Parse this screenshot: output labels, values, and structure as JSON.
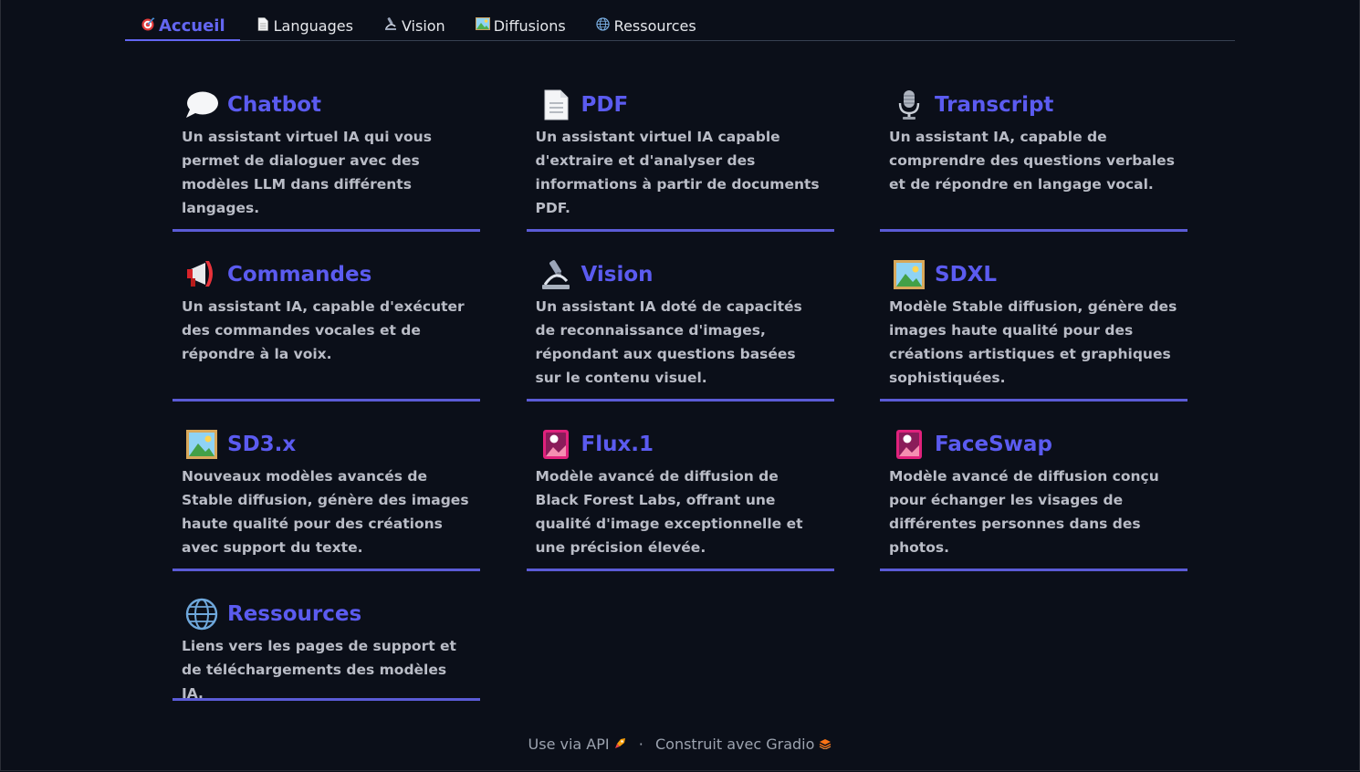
{
  "tabs": [
    {
      "label": "Accueil",
      "icon": "target-icon",
      "active": true
    },
    {
      "label": "Languages",
      "icon": "document-icon",
      "active": false
    },
    {
      "label": "Vision",
      "icon": "microscope-icon",
      "active": false
    },
    {
      "label": "Diffusions",
      "icon": "picture-icon",
      "active": false
    },
    {
      "label": "Ressources",
      "icon": "globe-icon",
      "active": false
    }
  ],
  "cards": [
    {
      "title": "Chatbot",
      "icon": "speech-bubble-icon",
      "desc": "Un assistant virtuel IA qui vous permet de dialoguer avec des modèles LLM dans différents langages."
    },
    {
      "title": "PDF",
      "icon": "document-icon",
      "desc": "Un assistant virtuel IA capable d'extraire et d'analyser des informations à partir de documents PDF."
    },
    {
      "title": "Transcript",
      "icon": "microphone-icon",
      "desc": "Un assistant IA, capable de comprendre des questions verbales et de répondre en langage vocal."
    },
    {
      "title": "Commandes",
      "icon": "megaphone-icon",
      "desc": "Un assistant IA, capable d'exécuter des commandes vocales et de répondre à la voix."
    },
    {
      "title": "Vision",
      "icon": "microscope-icon",
      "desc": "Un assistant IA doté de capacités de reconnaissance d'images, répondant aux questions basées sur le contenu visuel."
    },
    {
      "title": "SDXL",
      "icon": "picture-icon",
      "desc": "Modèle Stable diffusion, génère des images haute qualité pour des créations artistiques et graphiques sophistiquées."
    },
    {
      "title": "SD3.x",
      "icon": "picture-icon",
      "desc": "Nouveaux modèles avancés de Stable diffusion, génère des images haute qualité pour des créations avec support du texte."
    },
    {
      "title": "Flux.1",
      "icon": "pink-card-icon",
      "desc": "Modèle avancé de diffusion de Black Forest Labs, offrant une qualité d'image exceptionnelle et une précision élevée."
    },
    {
      "title": "FaceSwap",
      "icon": "pink-card-icon",
      "desc": "Modèle avancé de diffusion conçu pour échanger les visages de différentes personnes dans des photos."
    },
    {
      "title": "Ressources",
      "icon": "globe-icon",
      "desc": "Liens vers les pages de support et de téléchargements des modèles IA."
    }
  ],
  "footer": {
    "api_label": "Use via API",
    "separator": "·",
    "built_with": "Construit avec Gradio"
  },
  "colors": {
    "accent": "#5b5bf0",
    "background": "#0b0f19"
  }
}
